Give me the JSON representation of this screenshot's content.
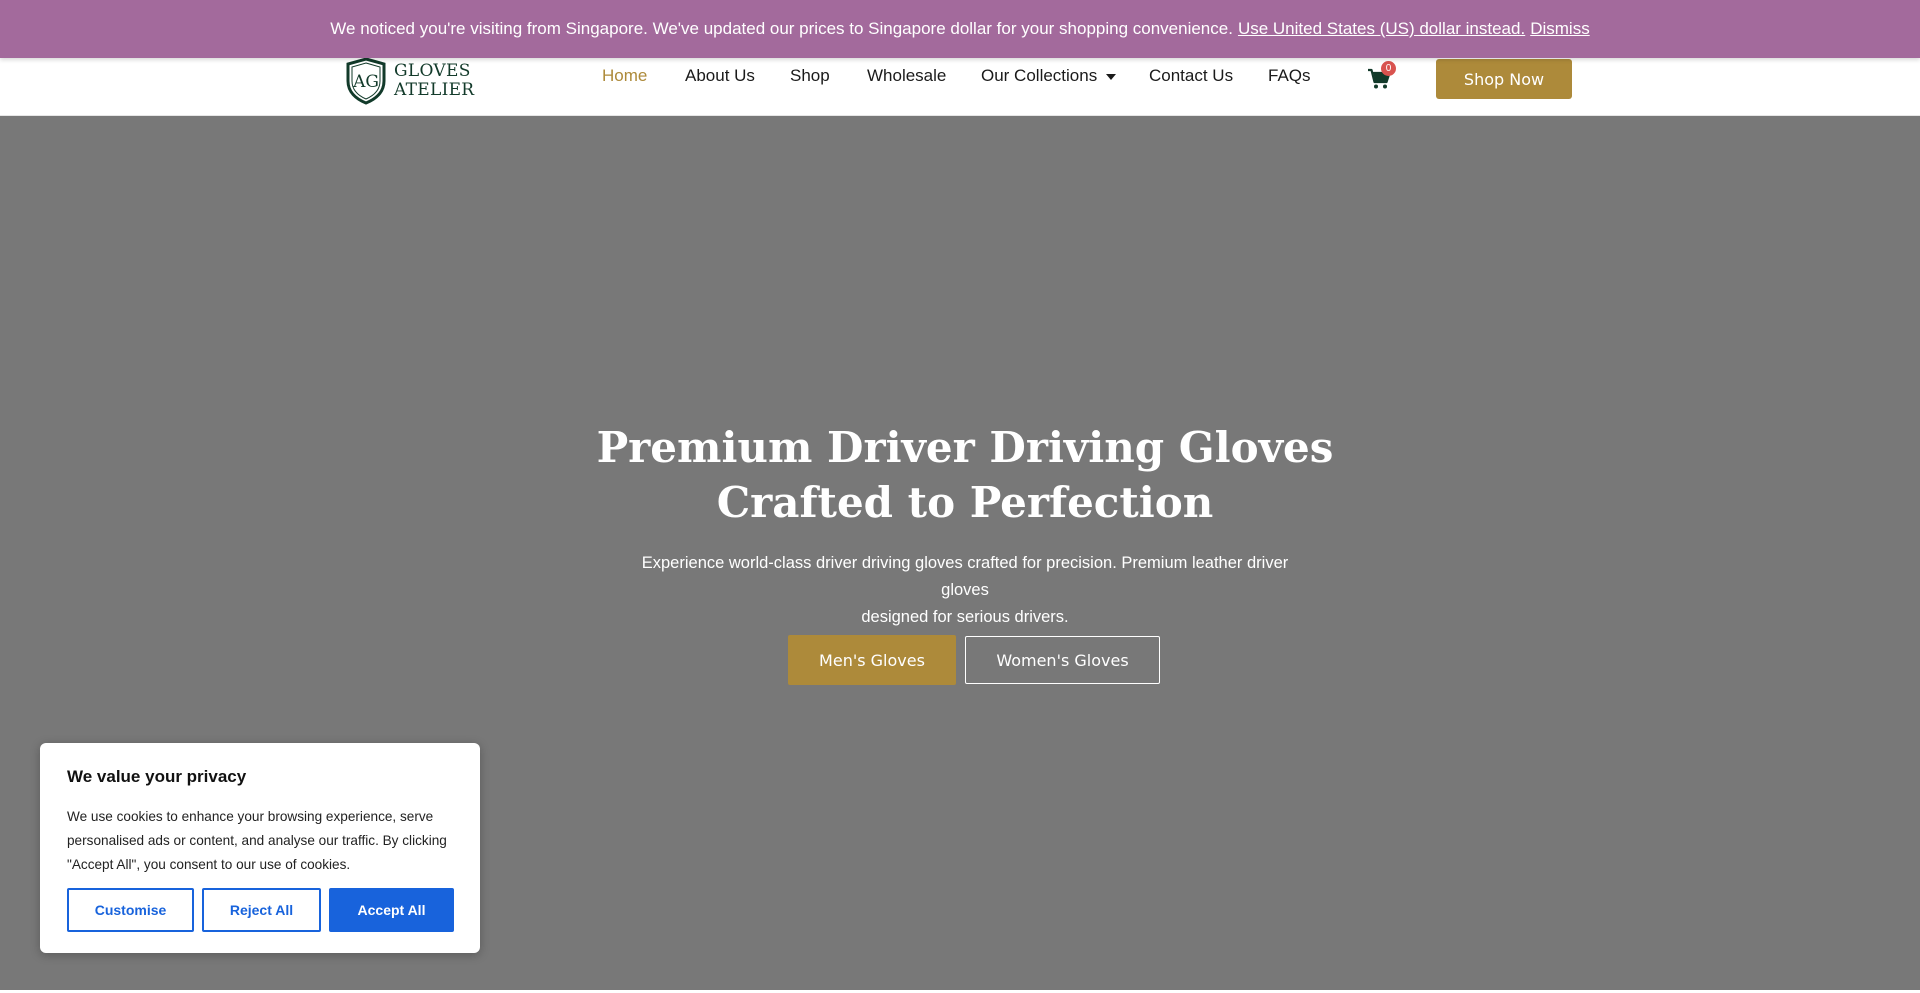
{
  "notice": {
    "message": "We noticed you're visiting from Singapore. We've updated our prices to Singapore dollar for your shopping convenience.",
    "usd_link": "Use United States (US) dollar instead.",
    "dismiss": "Dismiss"
  },
  "header": {
    "logo_line1": "GLOVES",
    "logo_line2": "ATELIER",
    "nav": {
      "home": "Home",
      "about": "About Us",
      "shop": "Shop",
      "wholesale": "Wholesale",
      "collections": "Our Collections",
      "contact": "Contact Us",
      "faqs": "FAQs"
    },
    "cart_count": "0",
    "shop_now": "Shop Now"
  },
  "hero": {
    "title_line1": "Premium Driver Driving Gloves",
    "title_line2": "Crafted to Perfection",
    "subtitle_line1": "Experience world-class driver driving gloves crafted for precision. Premium leather driver gloves",
    "subtitle_line2": "designed for serious drivers.",
    "btn_men": "Men's Gloves",
    "btn_women": "Women's Gloves"
  },
  "cookie": {
    "title": "We value your privacy",
    "text": "We use cookies to enhance your browsing experience, serve personalised ads or content, and analyse our traffic. By clicking \"Accept All\", you consent to our use of cookies.",
    "customise": "Customise",
    "reject": "Reject All",
    "accept": "Accept All"
  },
  "colors": {
    "notice_bg": "#a36a9c",
    "brand_gold": "#ad8a3a",
    "hero_bg": "#787878",
    "cookie_blue": "#1863dc",
    "logo_green": "#123a2a"
  },
  "icons": {
    "logo": "shield-monogram-icon",
    "cart": "cart-icon",
    "collections_caret": "caret-down-icon"
  }
}
